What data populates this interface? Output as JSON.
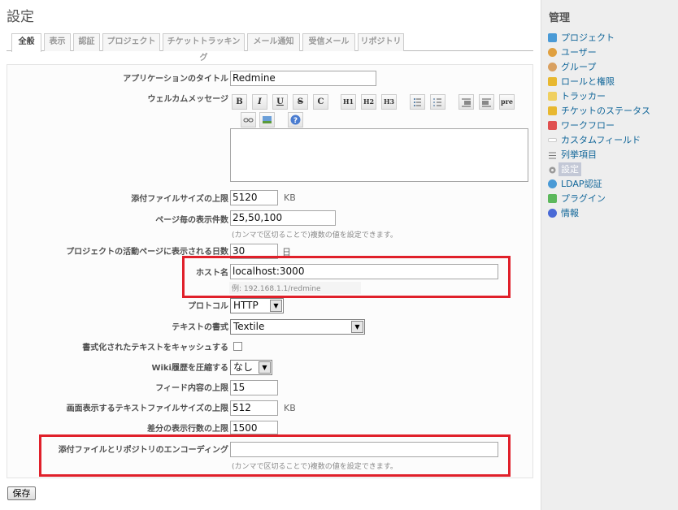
{
  "page": {
    "title": "設定"
  },
  "tabs": [
    "全般",
    "表示",
    "認証",
    "プロジェクト",
    "チケットトラッキング",
    "メール通知",
    "受信メール",
    "リポジトリ"
  ],
  "form": {
    "app_title_label": "アプリケーションのタイトル",
    "app_title_value": "Redmine",
    "welcome_label": "ウェルカムメッセージ",
    "attachment_label": "添付ファイルサイズの上限",
    "attachment_value": "5120",
    "attachment_unit": "KB",
    "per_page_label": "ページ毎の表示件数",
    "per_page_value": "25,50,100",
    "per_page_hint": "(カンマで区切ることで)複数の値を設定できます。",
    "activity_days_label": "プロジェクトの活動ページに表示される日数",
    "activity_days_value": "30",
    "activity_days_unit": "日",
    "host_label": "ホスト名",
    "host_value": "localhost:3000",
    "host_hint": "例: 192.168.1.1/redmine",
    "protocol_label": "プロトコル",
    "protocol_value": "HTTP",
    "text_format_label": "テキストの書式",
    "text_format_value": "Textile",
    "cache_label": "書式化されたテキストをキャッシュする",
    "wiki_compress_label": "Wiki履歴を圧縮する",
    "wiki_compress_value": "なし",
    "feed_limit_label": "フィード内容の上限",
    "feed_limit_value": "15",
    "file_max_label": "画面表示するテキストファイルサイズの上限",
    "file_max_value": "512",
    "file_max_unit": "KB",
    "diff_lines_label": "差分の表示行数の上限",
    "diff_lines_value": "1500",
    "encoding_label": "添付ファイルとリポジトリのエンコーディング",
    "encoding_value": "",
    "encoding_hint": "(カンマで区切ることで)複数の値を設定できます。"
  },
  "toolbar": {
    "bold": "B",
    "italic": "I",
    "underline": "U",
    "strike": "S",
    "code": "C",
    "h1": "H1",
    "h2": "H2",
    "h3": "H3",
    "pre": "pre"
  },
  "save_label": "保存",
  "sidebar": {
    "title": "管理",
    "items": [
      {
        "label": "プロジェクト",
        "icon": "projects-icon",
        "color": "#4a9ad6"
      },
      {
        "label": "ユーザー",
        "icon": "user-icon",
        "color": "#e0a040"
      },
      {
        "label": "グループ",
        "icon": "group-icon",
        "color": "#d9a060"
      },
      {
        "label": "ロールと権限",
        "icon": "key-icon",
        "color": "#e8b830"
      },
      {
        "label": "トラッカー",
        "icon": "ticket-icon",
        "color": "#f0d060"
      },
      {
        "label": "チケットのステータス",
        "icon": "status-icon",
        "color": "#e8b830"
      },
      {
        "label": "ワークフロー",
        "icon": "workflow-icon",
        "color": "#e05050"
      },
      {
        "label": "カスタムフィールド",
        "icon": "custom-field-icon",
        "color": "#ffffff"
      },
      {
        "label": "列挙項目",
        "icon": "list-icon",
        "color": "#888888"
      },
      {
        "label": "設定",
        "icon": "settings-icon",
        "color": "#888888"
      },
      {
        "label": "LDAP認証",
        "icon": "ldap-icon",
        "color": "#4a9ad6"
      },
      {
        "label": "プラグイン",
        "icon": "plugin-icon",
        "color": "#5cb85c"
      },
      {
        "label": "情報",
        "icon": "info-icon",
        "color": "#4a6ad6"
      }
    ]
  }
}
